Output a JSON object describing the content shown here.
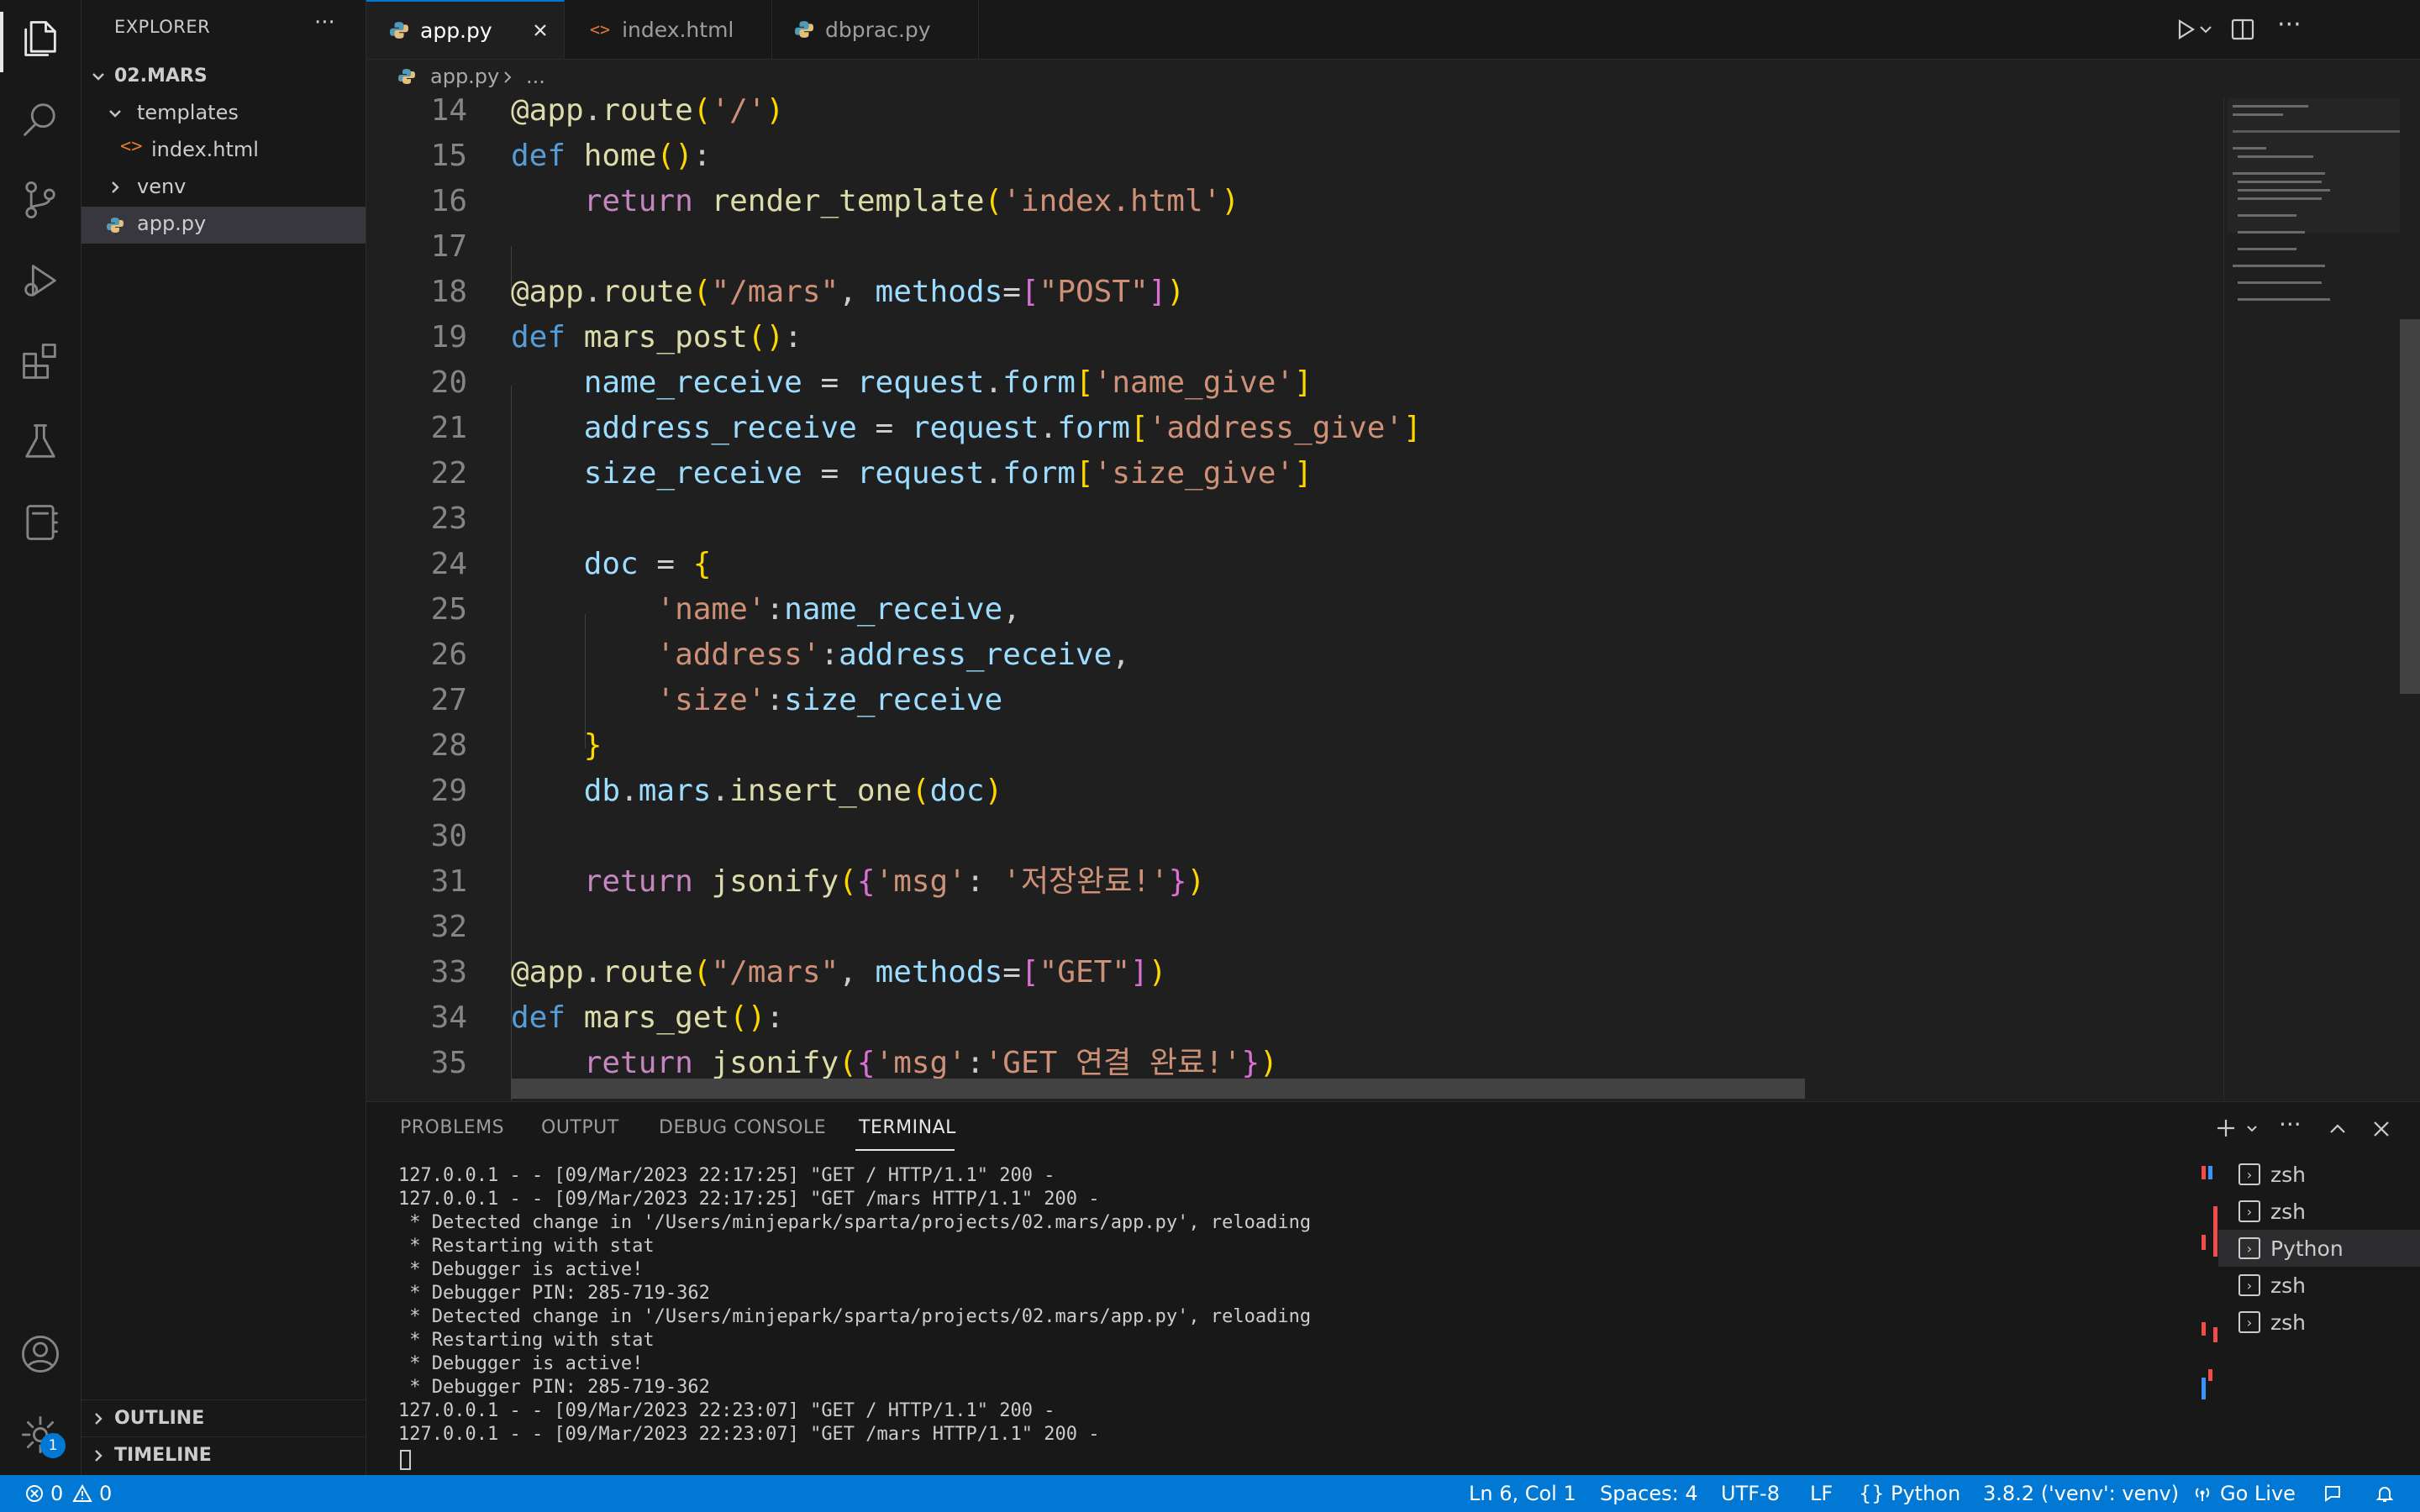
{
  "sidebar": {
    "title": "EXPLORER",
    "more_label": "···",
    "root": "02.MARS",
    "items": [
      {
        "label": "templates",
        "type": "folder-open"
      },
      {
        "label": "index.html",
        "type": "html-file"
      },
      {
        "label": "venv",
        "type": "folder-closed"
      },
      {
        "label": "app.py",
        "type": "python-file",
        "selected": true
      }
    ],
    "outline": "OUTLINE",
    "timeline": "TIMELINE"
  },
  "activity_badge": "1",
  "tabs": [
    {
      "label": "app.py",
      "active": true
    },
    {
      "label": "index.html",
      "active": false
    },
    {
      "label": "dbprac.py",
      "active": false
    }
  ],
  "breadcrumb": {
    "file": "app.py",
    "rest": "..."
  },
  "editor": {
    "line_numbers": [
      "14",
      "15",
      "16",
      "17",
      "18",
      "19",
      "20",
      "21",
      "22",
      "23",
      "24",
      "25",
      "26",
      "27",
      "28",
      "29",
      "30",
      "31",
      "32",
      "33",
      "34",
      "35"
    ]
  },
  "panel": {
    "tabs": [
      "PROBLEMS",
      "OUTPUT",
      "DEBUG CONSOLE",
      "TERMINAL"
    ],
    "terminal_lines": [
      "127.0.0.1 - - [09/Mar/2023 22:17:25] \"GET / HTTP/1.1\" 200 -",
      "127.0.0.1 - - [09/Mar/2023 22:17:25] \"GET /mars HTTP/1.1\" 200 -",
      " * Detected change in '/Users/minjepark/sparta/projects/02.mars/app.py', reloading",
      " * Restarting with stat",
      " * Debugger is active!",
      " * Debugger PIN: 285-719-362",
      " * Detected change in '/Users/minjepark/sparta/projects/02.mars/app.py', reloading",
      " * Restarting with stat",
      " * Debugger is active!",
      " * Debugger PIN: 285-719-362",
      "127.0.0.1 - - [09/Mar/2023 22:23:07] \"GET / HTTP/1.1\" 200 -",
      "127.0.0.1 - - [09/Mar/2023 22:23:07] \"GET /mars HTTP/1.1\" 200 -"
    ],
    "terminals": [
      {
        "label": "zsh",
        "active": false
      },
      {
        "label": "zsh",
        "active": false
      },
      {
        "label": "Python",
        "active": true
      },
      {
        "label": "zsh",
        "active": false
      },
      {
        "label": "zsh",
        "active": false
      }
    ]
  },
  "status": {
    "errors": "0",
    "warnings": "0",
    "position": "Ln 6, Col 1",
    "spaces": "Spaces: 4",
    "encoding": "UTF-8",
    "eol": "LF",
    "language": "Python",
    "interpreter": "3.8.2 ('venv': venv)",
    "golive": "Go Live"
  },
  "colors": {
    "accent": "#0078d4",
    "editor_bg": "#1f1f1f",
    "sidebar_bg": "#181818"
  }
}
